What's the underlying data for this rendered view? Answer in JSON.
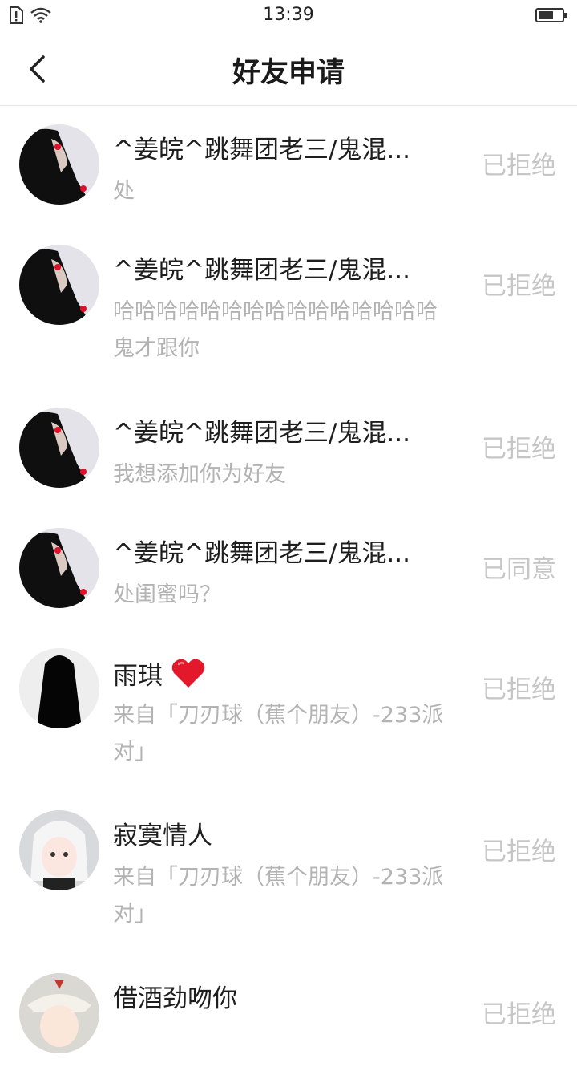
{
  "status_bar": {
    "time": "13:39"
  },
  "header": {
    "title": "好友申请"
  },
  "requests": [
    {
      "name": "^姜皖^跳舞团老三/鬼混...",
      "message": "处",
      "status": "已拒绝"
    },
    {
      "name": "^姜皖^跳舞团老三/鬼混...",
      "message": "哈哈哈哈哈哈哈哈哈哈哈哈哈哈哈鬼才跟你",
      "status": "已拒绝"
    },
    {
      "name": "^姜皖^跳舞团老三/鬼混...",
      "message": "我想添加你为好友",
      "status": "已拒绝"
    },
    {
      "name": "^姜皖^跳舞团老三/鬼混...",
      "message": "处闺蜜吗？",
      "status": "已同意"
    },
    {
      "name": "雨琪",
      "message": "来自「刀刃球（蕉个朋友）-233派对」",
      "status": "已拒绝"
    },
    {
      "name": "寂寞情人",
      "message": "来自「刀刃球（蕉个朋友）-233派对」",
      "status": "已拒绝"
    },
    {
      "name": "借酒劲吻你",
      "message": "",
      "status": "已拒绝"
    }
  ]
}
